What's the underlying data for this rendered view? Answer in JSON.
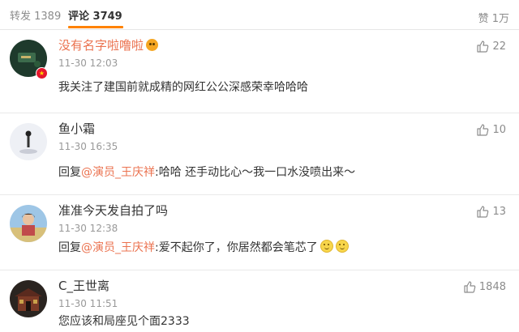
{
  "tabs": {
    "repost": "转发 1389",
    "comment": "评论 3749",
    "like": "赞 1万"
  },
  "comments": [
    {
      "name": "没有名字啦噜啦",
      "time": "11-30 12:03",
      "likes": "22",
      "text": "我关注了建国前就成精的网红公公深感荣幸哈哈哈"
    },
    {
      "name": "鱼小霜",
      "time": "11-30 16:35",
      "likes": "10",
      "reply_prefix": "回复",
      "mention": "@演员_王庆祥",
      "text": ":哈哈 还手动比心～我一口水没喷出来～"
    },
    {
      "name": "准准今天发自拍了吗",
      "time": "11-30 12:38",
      "likes": "13",
      "reply_prefix": "回复",
      "mention": "@演员_王庆祥",
      "text": ":爱不起你了，你居然都会笔芯了"
    },
    {
      "name": "C_王世离",
      "time": "11-30 11:51",
      "likes": "1848",
      "text": "您应该和局座见个面2333"
    }
  ],
  "colors": {
    "accent": "#ff8200",
    "link": "#eb7350",
    "vip_name": "#eb7350",
    "muted": "#999999"
  }
}
